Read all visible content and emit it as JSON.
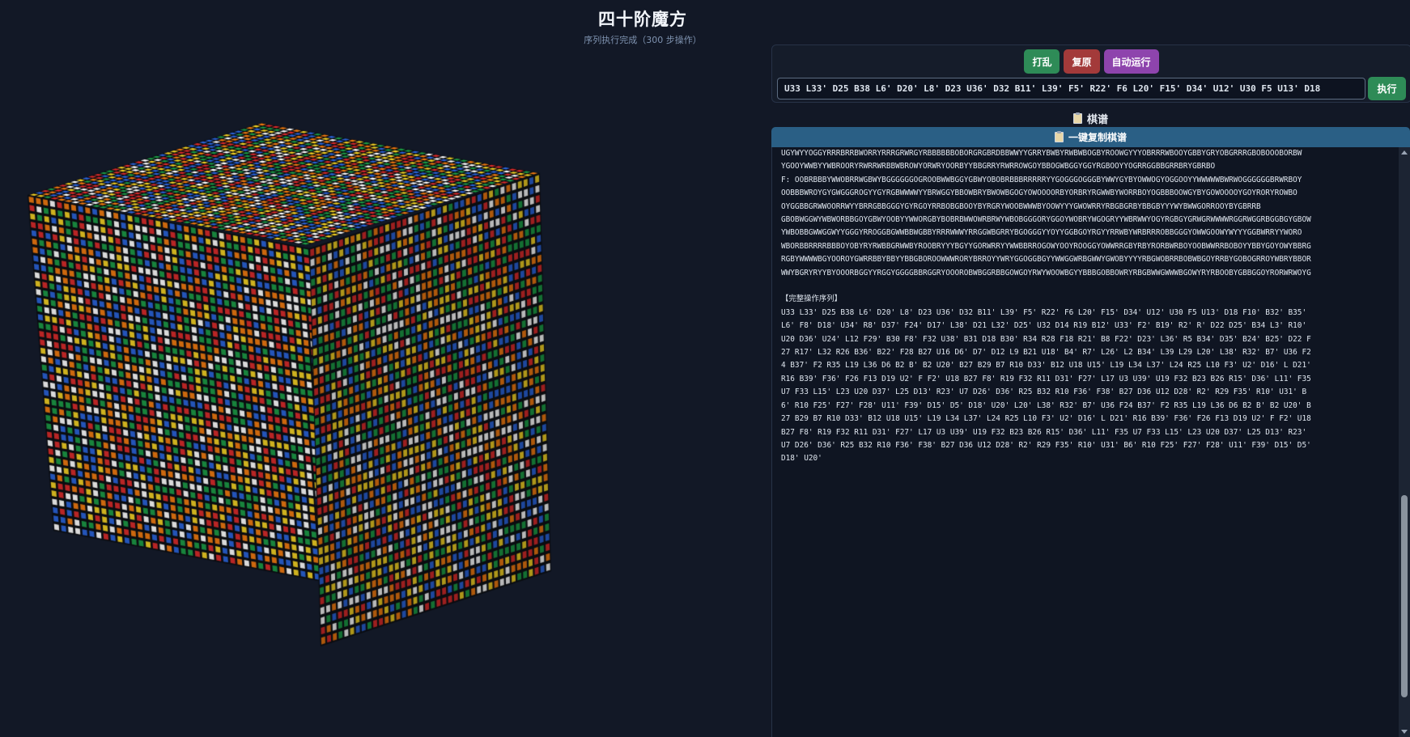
{
  "app": {
    "title": "四十阶魔方",
    "status": "序列执行完成（300 步操作）"
  },
  "controls": {
    "scramble_label": "打乱",
    "restore_label": "复原",
    "autorun_label": "自动运行",
    "sequence_value": "U33 L33' D25 B38 L6' D20' L8' D23 U36' D32 B11' L39' F5' R22' F6 L20' F15' D34' U12' U30 F5 U13' D18",
    "execute_label": "执行"
  },
  "record": {
    "heading": "棋谱",
    "copy_label": "一键复制棋谱"
  },
  "log": {
    "state_lines": [
      "UGYWYYOGGYRRRBRRBWORRYRRRGRWRGYRBBBBBBOBORGRGBRDBBWWYYGRRYBWBYRWBWBOGBYROOWGYYYOBRRRWBOOYGBBYGRYOBGRRRGBOBOOOBORBW",
      "YGOOYWWBYYWBROORYRWRRWRBBWBROWYORWRYOORBYYBBGRRYRWRROWGOYBBOGWBGGYGGYRGBOOYYOGRRGGBBGRRBRYGBRBO",
      "F: OOBRBBBYWWOBRRWGBWYBGGGGGGOGROOBWWBGGYGBWYOBOBRBBBRRRRRYYGOGGGOGGGBYWWYGYBYOWWOGYOGGOOYYWWWWWBWRWOGGGGGGBRWRBOY",
      "OOBBBWROYGYGWGGGROGYYGYRGBWWWWYYBRWGGYBBOWBRYBWOWBGOGYOWOOOORBYORBRYRGWWBYWORRBOYOGBBBOOWGYBYGOWOOOOYGOYRORYROWBO",
      "OYGGBBGRWWOORRWYYBRRGBBGGGYGYRGOYRRBOBGBOOYBYRGRYWOOBWWWBYOOWYYYGWOWRRYRBGBGRBYBBGBYYYWYBWWGORROOYBYGBRRB",
      "GBOBWGGWYWBWORBBGOYGBWYOOBYYWWORGBYBOBRBWWOWRBRWYWBOBGGGORYGGOYWOBRYWGOGRYYWBRWWYOGYRGBGYGRWGRWWWWRGGRWGGRBGGBGYGBOW",
      "YWBOBBGWWGGWYYGGGYRROGGBGWWBBWGBBYRRRWWWYRRGGWBGRRYBGOGGGYYOYYGGBGOYRGYYRRWBYWRBRRROBBGGGYOWWGOOWYWYYYGGBWRRYYWORO",
      "WBORBBRRRRBBBOYOBYRYRWBBGRWWBYROOBRYYYBGYYGORWRRYYWWBBRROGOWYOOYROOGGYOWWRRGBYRBYRORBWRBOYOOBWWRRBOBOYYBBYGOYOWYBBRG",
      "RGBYWWWWBGYOOROYGWRRBBYBBYYBBGBOROOWWWRORYBRROYYWRYGGOGGBGYYWWGGWRBGWWYGWOBYYYYRBGWOBRRBOBWBGOYRRBYGOBOGRROYWBRYBBOR",
      "WWYBGRYRYYBYOOORBGGYYRGGYGGGGBBRGGRYOOOROBWBGGRBBGOWGOYRWYWOOWBGYYBBBGOBBOWRYRBGBWWGWWWBGOWYRYRBOOBYGBBGGOYRORWRWOYG"
    ],
    "sequence_header": "【完整操作序列】",
    "sequence_lines": [
      "U33 L33' D25 B38 L6' D20' L8' D23 U36' D32 B11' L39' F5' R22' F6 L20' F15' D34' U12' U30 F5 U13' D18 F10' B32' B35'",
      "L6' F8' D18' U34' R8' D37' F24' D17' L38' D21 L32' D25' U32 D14 R19 B12' U33' F2' B19' R2' R' D22 D25' B34 L3' R10'",
      "U20 D36' U24' L12 F29' B30 F8' F32 U38' B31 D18 B30' R34 R28 F18 R21' B8 F22' D23' L36' R5 B34' D35' B24' B25' D22 F",
      "27 R17' L32 R26 B36' B22' F28 B27 U16 D6' D7' D12 L9 B21 U18' B4' R7' L26' L2 B34' L39 L29 L20' L38' R32' B7' U36 F2",
      "4 B37' F2 R35 L19 L36 D6 B2 B' B2 U20' B27 B29 B7 R10 D33' B12 U18 U15' L19 L34 L37' L24 R25 L10 F3' U2' D16' L D21'",
      "R16 B39' F36' F26 F13 D19 U2' F F2' U18 B27 F8' R19 F32 R11 D31' F27' L17 U3 U39' U19 F32 B23 B26 R15' D36' L11' F35",
      "U7 F33 L15' L23 U20 D37' L25 D13' R23' U7 D26' D36' R25 B32 R10 F36' F38' B27 D36 U12 D28' R2' R29 F35' R10' U31' B",
      "6' R10 F25' F27' F28' U11' F39' D15' D5' D18' U20' L20' L38' R32' B7' U36 F24 B37' F2 R35 L19 L36 D6 B2 B' B2 U20' B",
      "27 B29 B7 R10 D33' B12 U18 U15' L19 L34 L37' L24 R25 L10 F3' U2' D16' L D21' R16 B39' F36' F26 F13 D19 U2' F F2' U18",
      "B27 F8' R19 F32 R11 D31' F27' L17 U3 U39' U19 F32 B23 B26 R15' D36' L11' F35 U7 F33 L15' L23 U20 D37' L25 D13' R23'",
      "U7 D26' D36' R25 B32 R10 F36' F38' B27 D36 U12 D28' R2' R29 F35' R10' U31' B6' R10 F25' F27' F28' U11' F39' D15' D5'",
      "D18' U20'"
    ]
  },
  "cube": {
    "order": 40,
    "sticker_colors": [
      "#ffffff",
      "#f2d024",
      "#d92b2b",
      "#f07a10",
      "#2a63d8",
      "#1c9a46"
    ]
  }
}
